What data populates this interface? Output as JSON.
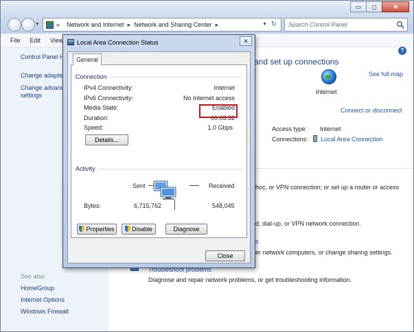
{
  "window": {
    "caption_min": "▭",
    "caption_max": "◻",
    "caption_close": "✕"
  },
  "address": {
    "history_chevron": "«",
    "crumb_1": "Network and Internet",
    "crumb_sep": "▸",
    "crumb_2": "Network and Sharing Center",
    "dropdown": "▼",
    "refresh": "↻"
  },
  "search": {
    "placeholder": "Search Control Panel"
  },
  "menu": [
    "File",
    "Edit",
    "View"
  ],
  "left_pane": {
    "home": "Control Panel H",
    "change_adapter": "Change adapter",
    "change_advanced_1": "Change advanc",
    "change_advanced_2": "settings",
    "see_also": "See also",
    "homegroup": "HomeGroup",
    "internet_options": "Internet Options",
    "windows_firewall": "Windows Firewall"
  },
  "right_pane": {
    "heading": "and set up connections",
    "see_full_map": "See full map",
    "internet_label": "Internet",
    "connect_disconnect": "Connect or disconnect",
    "access_type_label": "Access type:",
    "access_type_value": "Internet",
    "connections_label": "Connections:",
    "connections_value": "Local Area Connection",
    "line_1": "hoc, or VPN connection; or set up a router or access",
    "line_2": "d, dial-up, or VPN network connection.",
    "line_3_link": "s",
    "line_3": "er network computers, or change sharing settings.",
    "troubleshoot": "Troubleshoot problems",
    "troubleshoot_desc": "Diagnose and repair network problems, or get troubleshooting information."
  },
  "dialog": {
    "title": "Local Area Connection Status",
    "close": "✕",
    "tab": "General",
    "connection_group": "Connection",
    "rows": [
      {
        "label": "IPv4 Connectivity:",
        "value": "Internet"
      },
      {
        "label": "IPv6 Connectivity:",
        "value": "No Internet access"
      },
      {
        "label": "Media State:",
        "value": "Enabled"
      },
      {
        "label": "Duration:",
        "value": "00:03:32"
      },
      {
        "label": "Speed:",
        "value": "1.0 Gbps"
      }
    ],
    "details_button": "Details...",
    "activity_group": "Activity",
    "sent_label": "Sent",
    "received_label": "Received",
    "bytes_label": "Bytes:",
    "bytes_sent": "6,715,762",
    "bytes_received": "548,045",
    "properties_button": "Properties",
    "disable_button": "Disable",
    "diagnose_button": "Diagnose",
    "close_button": "Close"
  }
}
